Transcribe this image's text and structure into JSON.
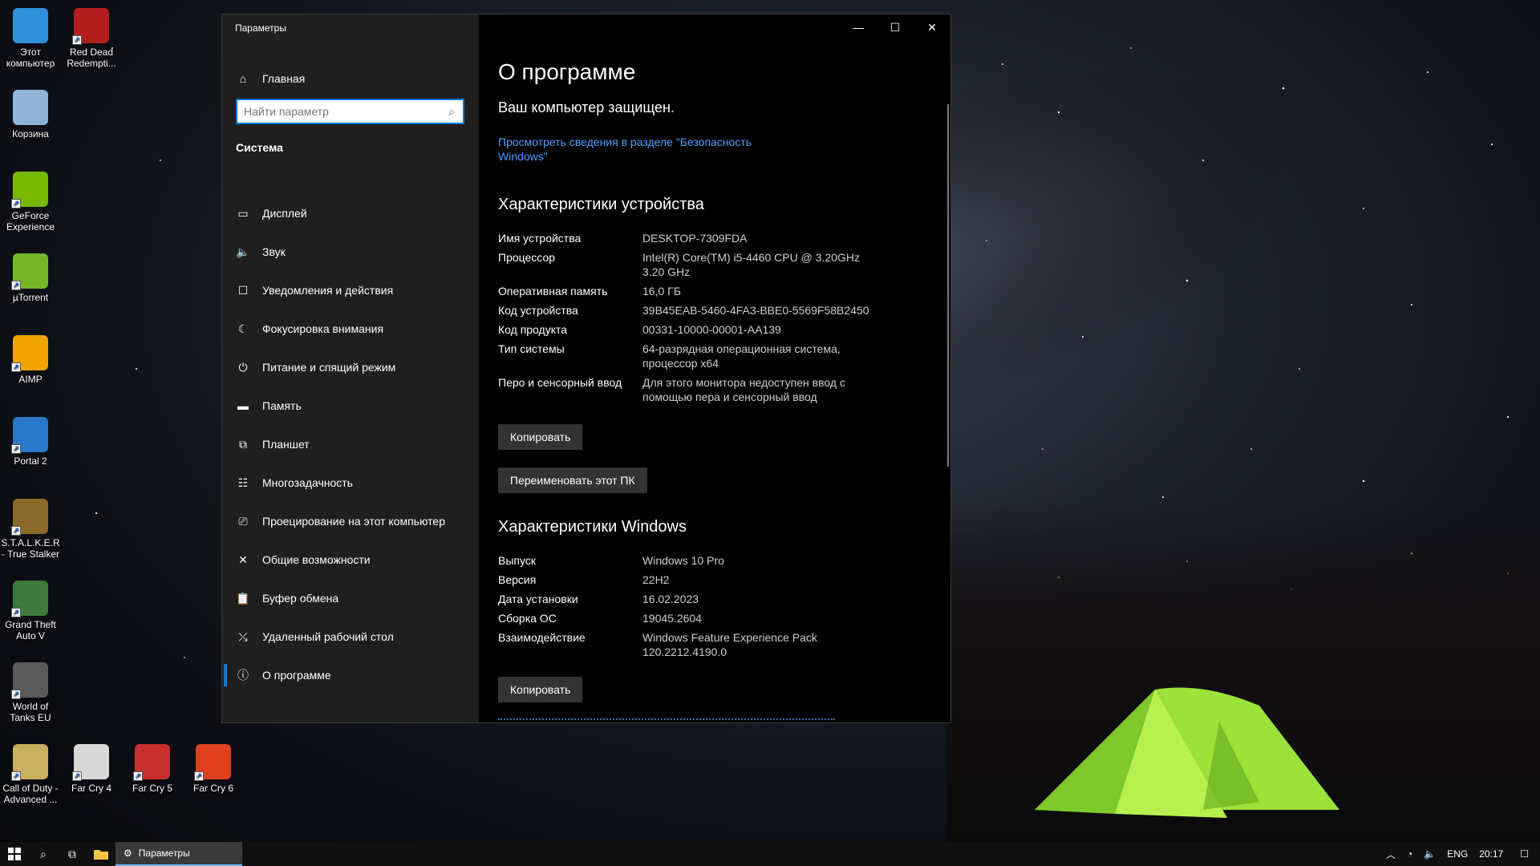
{
  "desktop": {
    "icons": [
      {
        "label": "Этот компьютер",
        "icon": "computer-icon",
        "color": "#2f8fd8"
      },
      {
        "label": "Red Dead Redempti...",
        "icon": "red-dead-icon",
        "color": "#b21e1e"
      },
      {
        "label": "Корзина",
        "icon": "recycle-bin-icon",
        "color": "#8fb4d8"
      },
      {
        "label": "GeForce Experience",
        "icon": "geforce-icon",
        "color": "#76b900"
      },
      {
        "label": "µTorrent",
        "icon": "utorrent-icon",
        "color": "#76b82a"
      },
      {
        "label": "AIMP",
        "icon": "aimp-icon",
        "color": "#f2a500"
      },
      {
        "label": "Portal 2",
        "icon": "portal-icon",
        "color": "#2a78c8"
      },
      {
        "label": "S.T.A.L.K.E.R - True Stalker",
        "icon": "stalker-icon",
        "color": "#8a6a2a"
      },
      {
        "label": "Grand Theft Auto V",
        "icon": "gta-icon",
        "color": "#3f7a3a"
      },
      {
        "label": "World of Tanks EU",
        "icon": "wot-icon",
        "color": "#5a5a5a"
      },
      {
        "label": "Call of Duty - Advanced ...",
        "icon": "cod-icon",
        "color": "#c8b060"
      },
      {
        "label": "Far Cry 4",
        "icon": "farcry4-icon",
        "color": "#d8d8d8"
      },
      {
        "label": "Far Cry 5",
        "icon": "farcry5-icon",
        "color": "#c83030"
      },
      {
        "label": "Far Cry 6",
        "icon": "farcry6-icon",
        "color": "#e04020"
      }
    ]
  },
  "window": {
    "title": "Параметры",
    "home_label": "Главная",
    "search_placeholder": "Найти параметр",
    "section": "Система",
    "nav": [
      {
        "label": "Дисплей",
        "icon": "display-icon",
        "glyph": "▭"
      },
      {
        "label": "Звук",
        "icon": "speaker-icon",
        "glyph": "🔈"
      },
      {
        "label": "Уведомления и действия",
        "icon": "notification-icon",
        "glyph": "☐"
      },
      {
        "label": "Фокусировка внимания",
        "icon": "moon-icon",
        "glyph": "☾"
      },
      {
        "label": "Питание и спящий режим",
        "icon": "power-icon",
        "glyph": "⏻"
      },
      {
        "label": "Память",
        "icon": "storage-icon",
        "glyph": "▬"
      },
      {
        "label": "Планшет",
        "icon": "tablet-icon",
        "glyph": "⧉"
      },
      {
        "label": "Многозадачность",
        "icon": "multitask-icon",
        "glyph": "☷"
      },
      {
        "label": "Проецирование на этот компьютер",
        "icon": "project-icon",
        "glyph": "⎚"
      },
      {
        "label": "Общие возможности",
        "icon": "share-icon",
        "glyph": "✕"
      },
      {
        "label": "Буфер обмена",
        "icon": "clipboard-icon",
        "glyph": "📋"
      },
      {
        "label": "Удаленный рабочий стол",
        "icon": "remote-icon",
        "glyph": "⤯"
      },
      {
        "label": "О программе",
        "icon": "info-icon",
        "glyph": "ⓘ",
        "active": true
      }
    ],
    "controls": {
      "minimize": "—",
      "maximize": "☐",
      "close": "✕"
    }
  },
  "about": {
    "title": "О программе",
    "protected": "Ваш компьютер защищен.",
    "security_link": "Просмотреть сведения в разделе \"Безопасность Windows\"",
    "device_header": "Характеристики устройства",
    "device_specs": [
      {
        "k": "Имя устройства",
        "v": "DESKTOP-7309FDA"
      },
      {
        "k": "Процессор",
        "v": "Intel(R) Core(TM) i5-4460  CPU @ 3.20GHz 3.20 GHz"
      },
      {
        "k": "Оперативная память",
        "v": "16,0 ГБ"
      },
      {
        "k": "Код устройства",
        "v": "39B45EAB-5460-4FA3-BBE0-5569F58B2450"
      },
      {
        "k": "Код продукта",
        "v": "00331-10000-00001-AA139"
      },
      {
        "k": "Тип системы",
        "v": "64-разрядная операционная система, процессор x64"
      },
      {
        "k": "Перо и сенсорный ввод",
        "v": "Для этого монитора недоступен ввод с помощью пера и сенсорный ввод"
      }
    ],
    "copy_label": "Копировать",
    "rename_label": "Переименовать этот ПК",
    "windows_header": "Характеристики Windows",
    "windows_specs": [
      {
        "k": "Выпуск",
        "v": "Windows 10 Pro"
      },
      {
        "k": "Версия",
        "v": "22H2"
      },
      {
        "k": "Дата установки",
        "v": "16.02.2023"
      },
      {
        "k": "Сборка ОС",
        "v": "19045.2604"
      },
      {
        "k": "Взаимодействие",
        "v": "Windows Feature Experience Pack 120.2212.4190.0"
      }
    ],
    "copy2_label": "Копировать"
  },
  "taskbar": {
    "task_label": "Параметры",
    "lang": "ENG",
    "time": "20:17"
  },
  "colors": {
    "accent": "#0078d7",
    "link": "#4ba0ff",
    "sidebar": "#1f1f1f"
  }
}
